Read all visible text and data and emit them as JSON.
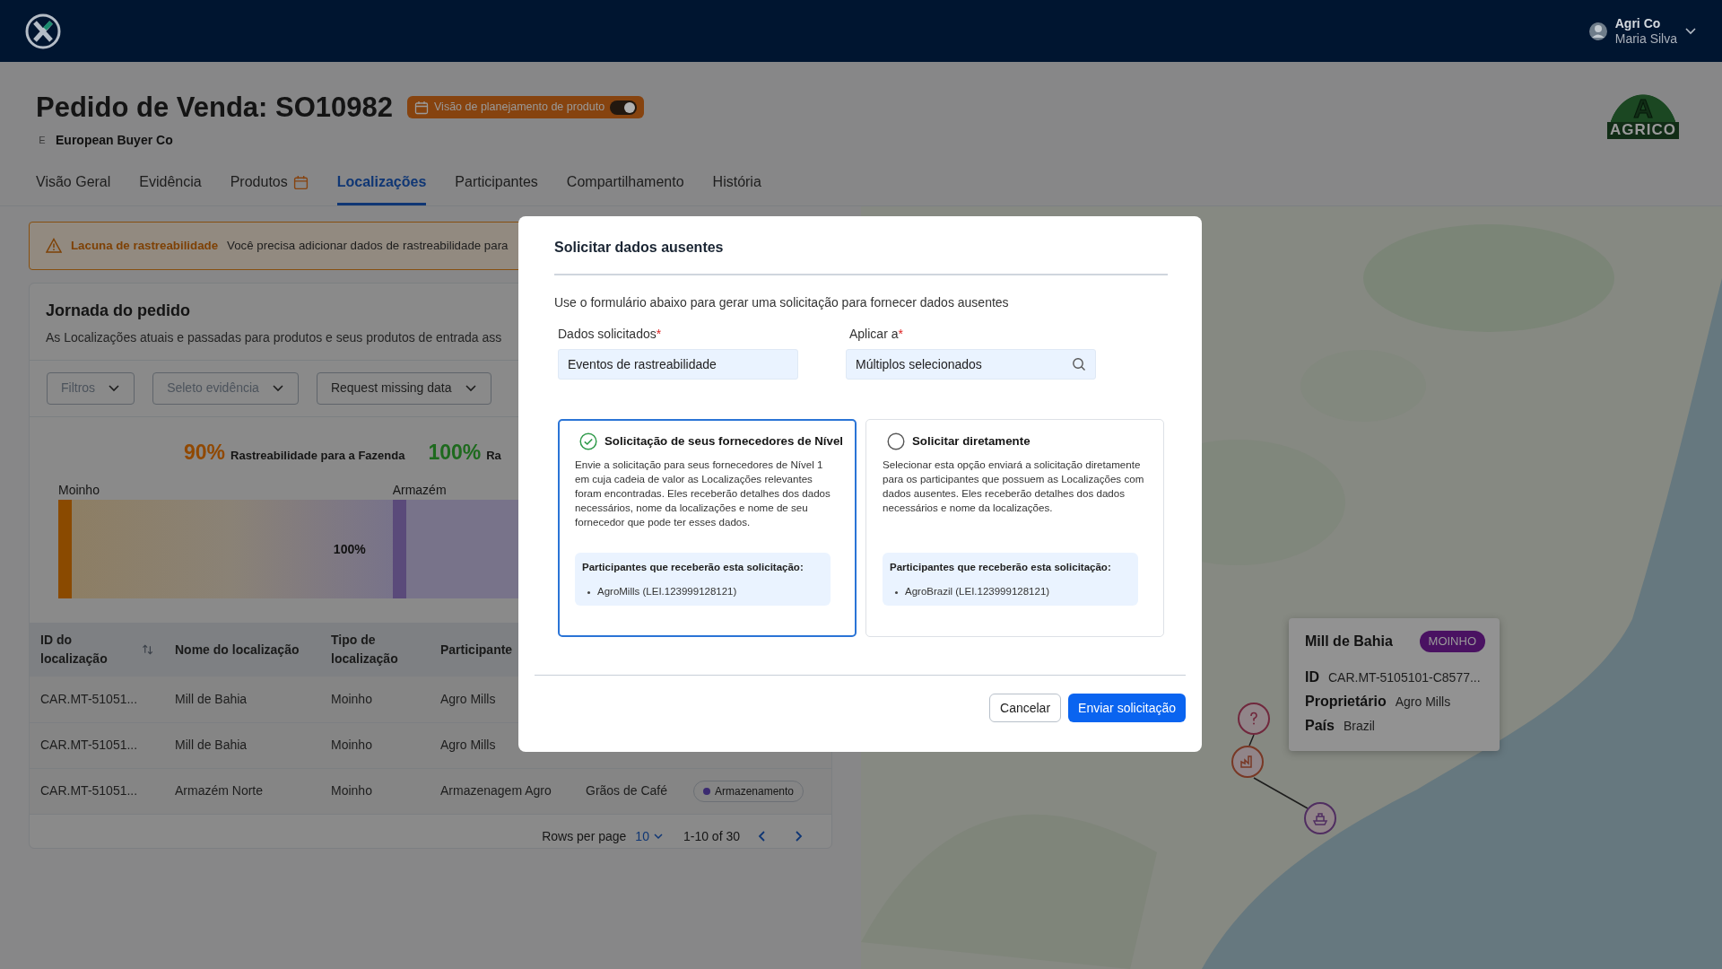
{
  "header": {
    "org": "Agri Co",
    "user": "Maria Silva"
  },
  "page": {
    "title": "Pedido de Venda: SO10982",
    "toggle": {
      "label": "Visão de planejamento de produto",
      "on": true
    },
    "buyer_initial": "E",
    "buyer": "European Buyer Co",
    "brand": {
      "letter": "A",
      "name": "AGRICO"
    }
  },
  "tabs": [
    {
      "label": "Visão Geral",
      "selected": false,
      "kind": "text"
    },
    {
      "label": "Evidência",
      "selected": false,
      "kind": "text"
    },
    {
      "label": "Produtos",
      "selected": false,
      "kind": "calendar"
    },
    {
      "label": "Localizações",
      "selected": true,
      "kind": "text"
    },
    {
      "label": "Participantes",
      "selected": false,
      "kind": "text"
    },
    {
      "label": "Compartilhamento",
      "selected": false,
      "kind": "text"
    },
    {
      "label": "História",
      "selected": false,
      "kind": "text"
    }
  ],
  "alert": {
    "title": "Lacuna de rastreabilidade",
    "text": "Você precisa adicionar dados de rastreabilidade para"
  },
  "journey": {
    "title": "Jornada do pedido",
    "subtitle": "As Localizações atuais e passadas para produtos e seus produtos de entrada ass",
    "filters": [
      {
        "label": "Filtros",
        "muted": true
      },
      {
        "label": "Seleto evidência",
        "muted": true
      },
      {
        "label": "Request missing data",
        "muted": false
      }
    ],
    "stats": [
      {
        "value": "90%",
        "label": "Rastreabilidade para a Fazenda",
        "color": "#904800"
      },
      {
        "value": "100%",
        "label": "Ra",
        "color": "#1e6a1e"
      }
    ],
    "segments": [
      {
        "label": "Moinho",
        "value": "100%",
        "color": "#8a4a00"
      },
      {
        "label": "Armazém",
        "color": "#5a4a7a"
      }
    ]
  },
  "table": {
    "columns": [
      {
        "label": "ID do localização",
        "sortable": true
      },
      {
        "label": "Nome do localização",
        "sortable": false
      },
      {
        "label": "Tipo de localização",
        "sortable": false
      },
      {
        "label": "Participante",
        "sortable": false
      }
    ],
    "rows": [
      {
        "cells": [
          "CAR.MT-51051...",
          "Mill de Bahia",
          "Moinho",
          "Agro Mills"
        ]
      },
      {
        "cells": [
          "CAR.MT-51051...",
          "Mill de Bahia",
          "Moinho",
          "Agro Mills"
        ]
      },
      {
        "cells": [
          "CAR.MT-51051...",
          "Armazém Norte",
          "Moinho",
          "Armazenagem Agro",
          "Grãos de Café"
        ],
        "status": {
          "label": "Armazenamento",
          "color": "#3a2a70"
        }
      }
    ],
    "pagination": {
      "rows_label": "Rows per page",
      "rows_value": "10",
      "range": "1-10 of 30"
    }
  },
  "map": {
    "kind": "picture",
    "markers": [
      {
        "kind": "question"
      },
      {
        "kind": "factory"
      },
      {
        "kind": "ship"
      }
    ],
    "popup": {
      "title": "Mill de Bahia",
      "badge": "MOINHO",
      "fields": [
        {
          "label": "ID",
          "value": "CAR.MT-5105101-C8577..."
        },
        {
          "label": "Proprietário",
          "value": "Agro Mills"
        },
        {
          "label": "País",
          "value": "Brazil"
        }
      ]
    }
  },
  "modal": {
    "title": "Solicitar dados ausentes",
    "intro": "Use o formulário abaixo para gerar uma solicitação para fornecer dados ausentes",
    "fields": [
      {
        "label": "Dados solicitados",
        "required_mark": "*",
        "value": "Eventos de rastreabilidade",
        "kind": "text"
      },
      {
        "label": "Aplicar a",
        "required_mark": "*",
        "value": "Múltiplos selecionados",
        "kind": "search"
      }
    ],
    "options": [
      {
        "title": "Solicitação de seus fornecedores de Nível",
        "selected": true,
        "text": "Envie a solicitação para seus fornecedores de Nível 1 em cuja cadeia de valor as Localizações relevantes foram encontradas. Eles receberão detalhes dos dados necessários, nome da localizações e nome de seu fornecedor que pode ter esses dados.",
        "recipients_title": "Participantes que receberão esta solicitação:",
        "recipients": [
          "AgroMills (LEI.123999128121)"
        ]
      },
      {
        "title": "Solicitar diretamente",
        "selected": false,
        "text": "Selecionar esta opção enviará a solicitação diretamente para os participantes que possuem as Localizações com dados ausentes. Eles receberão detalhes dos dados necessários e nome da localizações.",
        "recipients_title": "Participantes que receberão esta solicitação:",
        "recipients": [
          "AgroBrazil (LEI.123999128121)"
        ]
      }
    ],
    "buttons": [
      {
        "label": "Cancelar",
        "kind": "secondary"
      },
      {
        "label": "Enviar solicitação",
        "kind": "primary"
      }
    ]
  }
}
